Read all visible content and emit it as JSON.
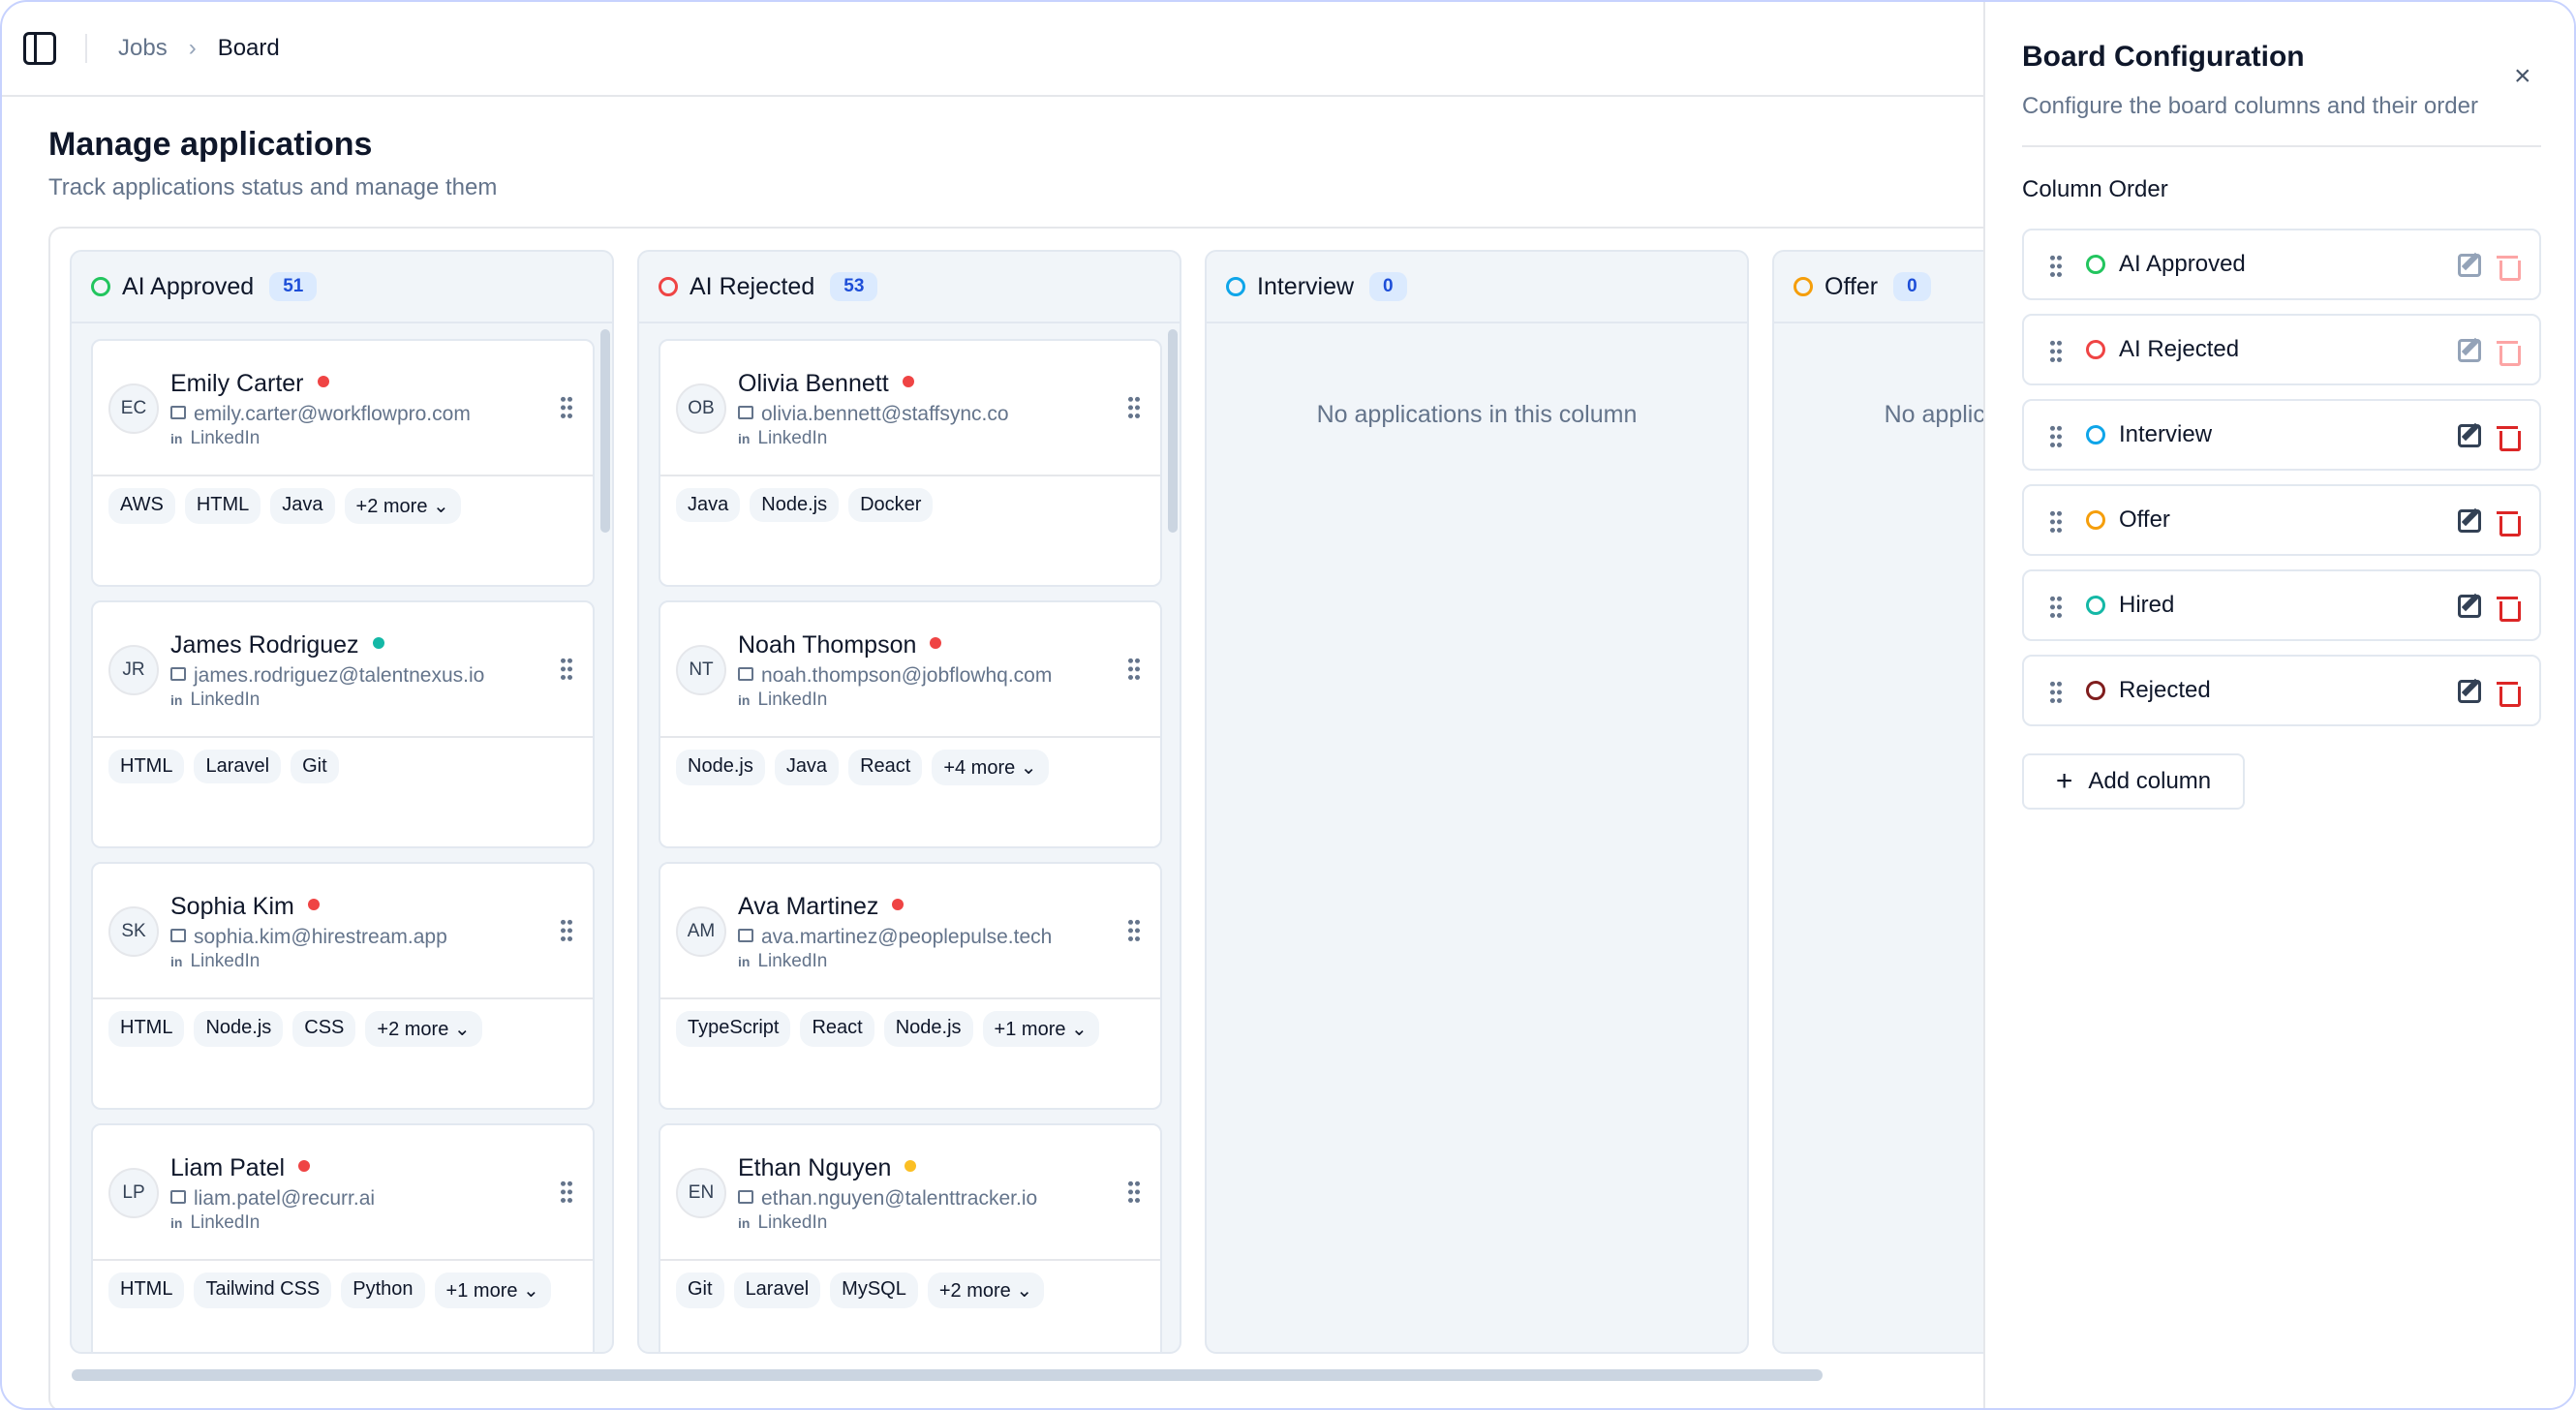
{
  "breadcrumb": {
    "items": [
      "Jobs",
      "Board"
    ],
    "separator": "›"
  },
  "header": {
    "title": "Manage applications",
    "subtitle": "Track applications status and manage them"
  },
  "board": {
    "columns": [
      {
        "name": "AI Approved",
        "count": "51",
        "color": "#22c55e",
        "cards": [
          {
            "initials": "EC",
            "name": "Emily Carter",
            "status_color": "#ef4444",
            "email": "emily.carter@workflowpro.com",
            "link": "LinkedIn",
            "skills": [
              "AWS",
              "HTML",
              "Java",
              "+2 more ⌄"
            ]
          },
          {
            "initials": "JR",
            "name": "James Rodriguez",
            "status_color": "#14b8a6",
            "email": "james.rodriguez@talentnexus.io",
            "link": "LinkedIn",
            "skills": [
              "HTML",
              "Laravel",
              "Git"
            ]
          },
          {
            "initials": "SK",
            "name": "Sophia Kim",
            "status_color": "#ef4444",
            "email": "sophia.kim@hirestream.app",
            "link": "LinkedIn",
            "skills": [
              "HTML",
              "Node.js",
              "CSS",
              "+2 more ⌄"
            ]
          },
          {
            "initials": "LP",
            "name": "Liam Patel",
            "status_color": "#ef4444",
            "email": "liam.patel@recurr.ai",
            "link": "LinkedIn",
            "skills": [
              "HTML",
              "Tailwind CSS",
              "Python",
              "+1 more ⌄"
            ]
          }
        ]
      },
      {
        "name": "AI Rejected",
        "count": "53",
        "color": "#ef4444",
        "cards": [
          {
            "initials": "OB",
            "name": "Olivia Bennett",
            "status_color": "#ef4444",
            "email": "olivia.bennett@staffsync.co",
            "link": "LinkedIn",
            "skills": [
              "Java",
              "Node.js",
              "Docker"
            ]
          },
          {
            "initials": "NT",
            "name": "Noah Thompson",
            "status_color": "#ef4444",
            "email": "noah.thompson@jobflowhq.com",
            "link": "LinkedIn",
            "skills": [
              "Node.js",
              "Java",
              "React",
              "+4 more ⌄"
            ]
          },
          {
            "initials": "AM",
            "name": "Ava Martinez",
            "status_color": "#ef4444",
            "email": "ava.martinez@peoplepulse.tech",
            "link": "LinkedIn",
            "skills": [
              "TypeScript",
              "React",
              "Node.js",
              "+1 more ⌄"
            ]
          },
          {
            "initials": "EN",
            "name": "Ethan Nguyen",
            "status_color": "#fbbf24",
            "email": "ethan.nguyen@talenttracker.io",
            "link": "LinkedIn",
            "skills": [
              "Git",
              "Laravel",
              "MySQL",
              "+2 more ⌄"
            ]
          }
        ]
      },
      {
        "name": "Interview",
        "count": "0",
        "color": "#0ea5e9",
        "empty_text": "No applications in this column",
        "cards": []
      },
      {
        "name": "Offer",
        "count": "0",
        "color": "#f59e0b",
        "empty_text": "No applications in this column",
        "cards": []
      }
    ]
  },
  "panel": {
    "title": "Board Configuration",
    "subtitle": "Configure the board columns and their order",
    "close_icon": "×",
    "section_label": "Column Order",
    "rows": [
      {
        "label": "AI Approved",
        "color": "#22c55e"
      },
      {
        "label": "AI Rejected",
        "color": "#ef4444"
      },
      {
        "label": "Interview",
        "color": "#0ea5e9"
      },
      {
        "label": "Offer",
        "color": "#f59e0b"
      },
      {
        "label": "Hired",
        "color": "#14b8a6"
      },
      {
        "label": "Rejected",
        "color": "#7f1d1d"
      }
    ],
    "add_button": "Add column",
    "add_icon": "+"
  }
}
